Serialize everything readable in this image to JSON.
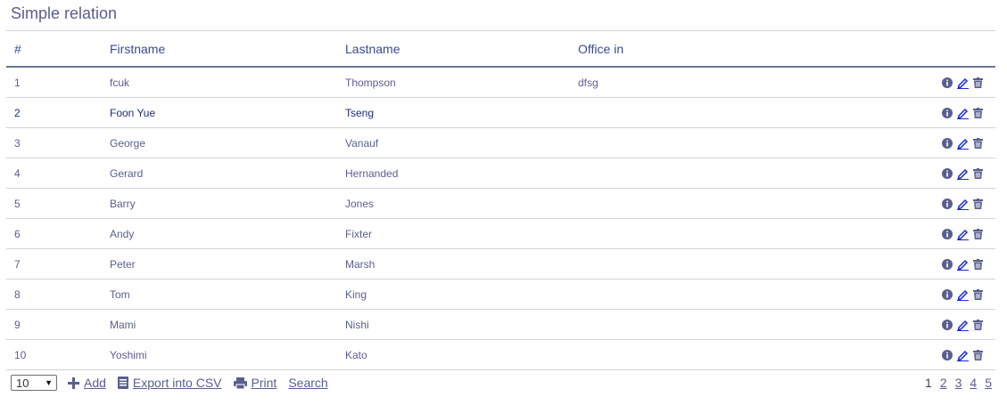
{
  "title": "Simple relation",
  "columns": [
    "#",
    "Firstname",
    "Lastname",
    "Office in"
  ],
  "rows": [
    {
      "num": "1",
      "first": "fcuk",
      "last": "Thompson",
      "office": "dfsg"
    },
    {
      "num": "2",
      "first": "Foon Yue",
      "last": "Tseng",
      "office": ""
    },
    {
      "num": "3",
      "first": "George",
      "last": "Vanauf",
      "office": ""
    },
    {
      "num": "4",
      "first": "Gerard",
      "last": "Hernanded",
      "office": ""
    },
    {
      "num": "5",
      "first": "Barry",
      "last": "Jones",
      "office": ""
    },
    {
      "num": "6",
      "first": "Andy",
      "last": "Fixter",
      "office": ""
    },
    {
      "num": "7",
      "first": "Peter",
      "last": "Marsh",
      "office": ""
    },
    {
      "num": "8",
      "first": "Tom",
      "last": "King",
      "office": ""
    },
    {
      "num": "9",
      "first": "Mami",
      "last": "Nishi",
      "office": ""
    },
    {
      "num": "10",
      "first": "Yoshimi",
      "last": "Kato",
      "office": ""
    }
  ],
  "row_icons": [
    "info-icon",
    "edit-icon",
    "trash-icon"
  ],
  "footer": {
    "page_size": "10",
    "add_label": "Add",
    "export_label": "Export into CSV",
    "print_label": "Print",
    "search_label": "Search"
  },
  "pagination": {
    "pages": [
      "1",
      "2",
      "3",
      "4",
      "5"
    ],
    "current": "1"
  },
  "colors": {
    "text": "#5a5e8f",
    "header": "#3a4a92",
    "highlight": "#1e2a7a",
    "edit_icon": "#1a2ad0",
    "icon": "#5a5e8f"
  }
}
